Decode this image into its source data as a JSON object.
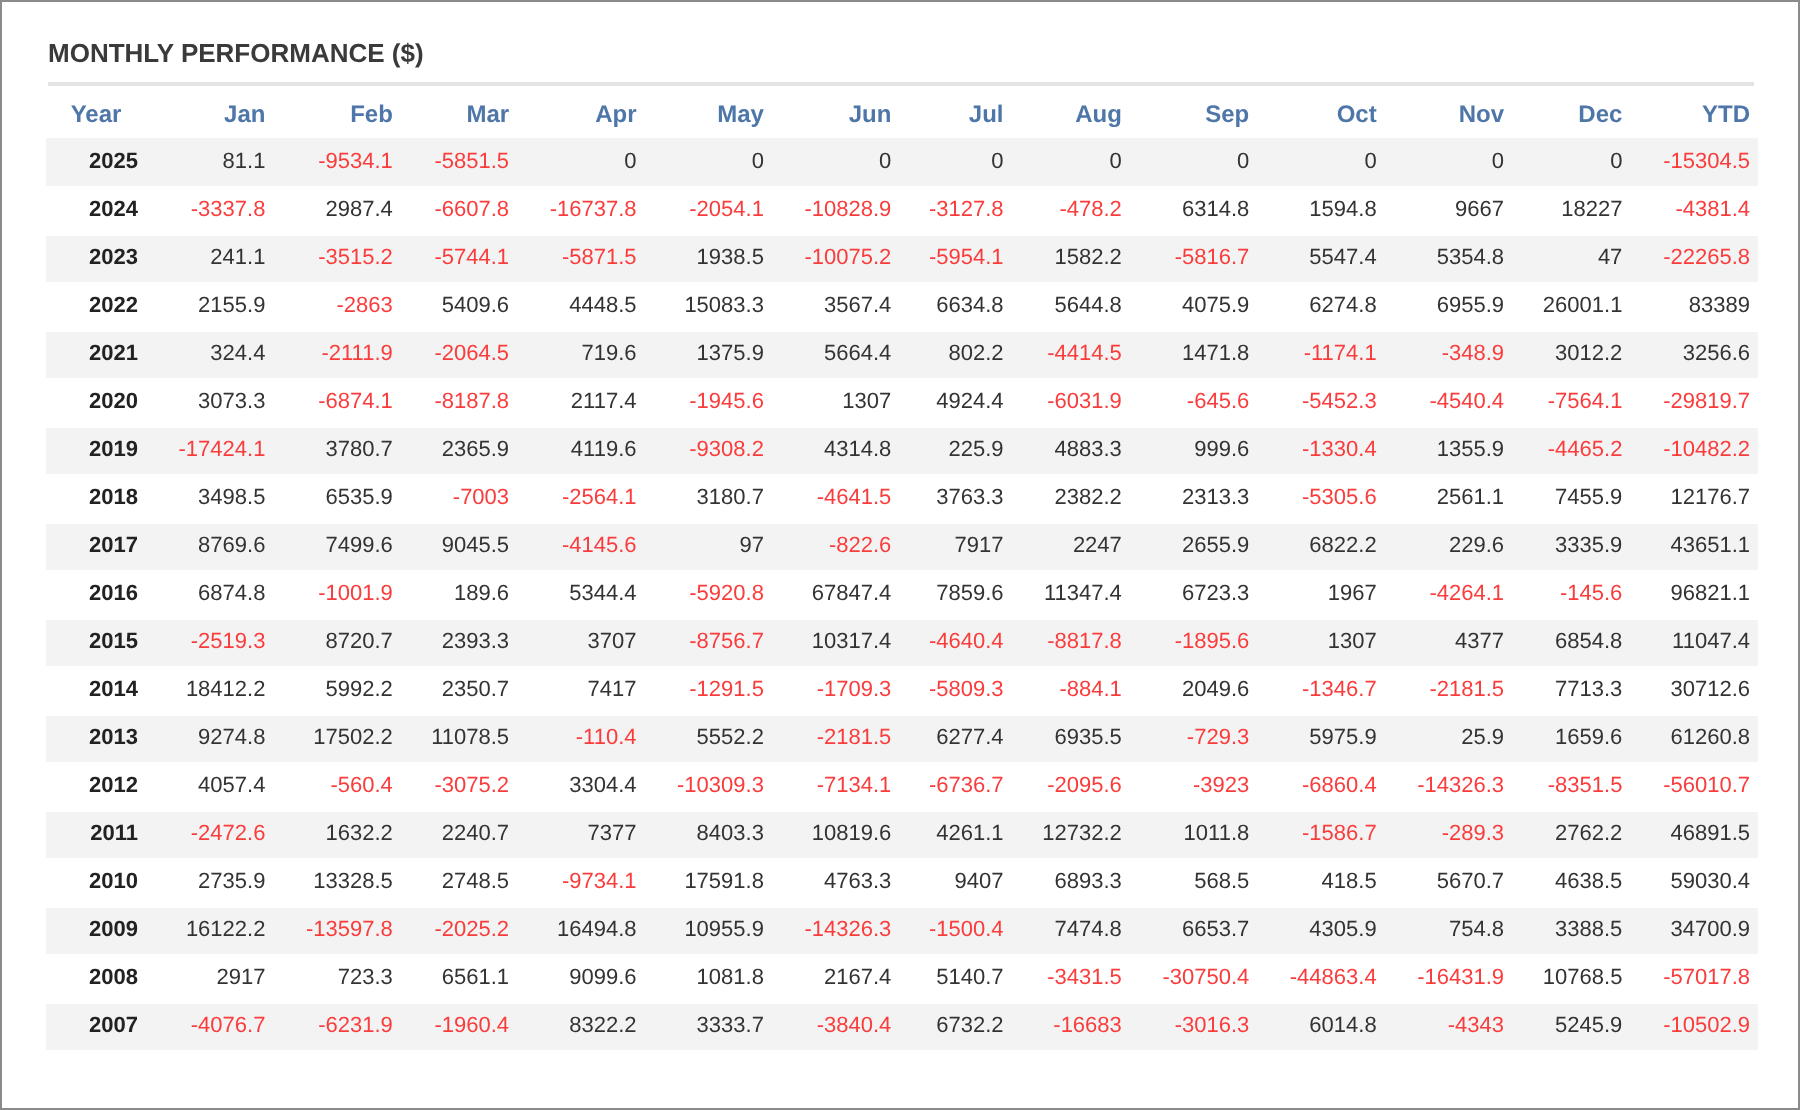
{
  "title": "MONTHLY PERFORMANCE ($)",
  "table": {
    "columns": [
      "Year",
      "Jan",
      "Feb",
      "Mar",
      "Apr",
      "May",
      "Jun",
      "Jul",
      "Aug",
      "Sep",
      "Oct",
      "Nov",
      "Dec",
      "YTD"
    ],
    "rows": [
      {
        "cells": [
          {
            "text": "2025"
          },
          {
            "text": "81.1",
            "negative": false
          },
          {
            "text": "-9534.1",
            "negative": true
          },
          {
            "text": "-5851.5",
            "negative": true
          },
          {
            "text": "0",
            "negative": false
          },
          {
            "text": "0",
            "negative": false
          },
          {
            "text": "0",
            "negative": false
          },
          {
            "text": "0",
            "negative": false
          },
          {
            "text": "0",
            "negative": false
          },
          {
            "text": "0",
            "negative": false
          },
          {
            "text": "0",
            "negative": false
          },
          {
            "text": "0",
            "negative": false
          },
          {
            "text": "0",
            "negative": false
          },
          {
            "text": "-15304.5",
            "negative": true
          }
        ]
      },
      {
        "cells": [
          {
            "text": "2024"
          },
          {
            "text": "-3337.8",
            "negative": true
          },
          {
            "text": "2987.4",
            "negative": false
          },
          {
            "text": "-6607.8",
            "negative": true
          },
          {
            "text": "-16737.8",
            "negative": true
          },
          {
            "text": "-2054.1",
            "negative": true
          },
          {
            "text": "-10828.9",
            "negative": true
          },
          {
            "text": "-3127.8",
            "negative": true
          },
          {
            "text": "-478.2",
            "negative": true
          },
          {
            "text": "6314.8",
            "negative": false
          },
          {
            "text": "1594.8",
            "negative": false
          },
          {
            "text": "9667",
            "negative": false
          },
          {
            "text": "18227",
            "negative": false
          },
          {
            "text": "-4381.4",
            "negative": true
          }
        ]
      },
      {
        "cells": [
          {
            "text": "2023"
          },
          {
            "text": "241.1",
            "negative": false
          },
          {
            "text": "-3515.2",
            "negative": true
          },
          {
            "text": "-5744.1",
            "negative": true
          },
          {
            "text": "-5871.5",
            "negative": true
          },
          {
            "text": "1938.5",
            "negative": false
          },
          {
            "text": "-10075.2",
            "negative": true
          },
          {
            "text": "-5954.1",
            "negative": true
          },
          {
            "text": "1582.2",
            "negative": false
          },
          {
            "text": "-5816.7",
            "negative": true
          },
          {
            "text": "5547.4",
            "negative": false
          },
          {
            "text": "5354.8",
            "negative": false
          },
          {
            "text": "47",
            "negative": false
          },
          {
            "text": "-22265.8",
            "negative": true
          }
        ]
      },
      {
        "cells": [
          {
            "text": "2022"
          },
          {
            "text": "2155.9",
            "negative": false
          },
          {
            "text": "-2863",
            "negative": true
          },
          {
            "text": "5409.6",
            "negative": false
          },
          {
            "text": "4448.5",
            "negative": false
          },
          {
            "text": "15083.3",
            "negative": false
          },
          {
            "text": "3567.4",
            "negative": false
          },
          {
            "text": "6634.8",
            "negative": false
          },
          {
            "text": "5644.8",
            "negative": false
          },
          {
            "text": "4075.9",
            "negative": false
          },
          {
            "text": "6274.8",
            "negative": false
          },
          {
            "text": "6955.9",
            "negative": false
          },
          {
            "text": "26001.1",
            "negative": false
          },
          {
            "text": "83389",
            "negative": false
          }
        ]
      },
      {
        "cells": [
          {
            "text": "2021"
          },
          {
            "text": "324.4",
            "negative": false
          },
          {
            "text": "-2111.9",
            "negative": true
          },
          {
            "text": "-2064.5",
            "negative": true
          },
          {
            "text": "719.6",
            "negative": false
          },
          {
            "text": "1375.9",
            "negative": false
          },
          {
            "text": "5664.4",
            "negative": false
          },
          {
            "text": "802.2",
            "negative": false
          },
          {
            "text": "-4414.5",
            "negative": true
          },
          {
            "text": "1471.8",
            "negative": false
          },
          {
            "text": "-1174.1",
            "negative": true
          },
          {
            "text": "-348.9",
            "negative": true
          },
          {
            "text": "3012.2",
            "negative": false
          },
          {
            "text": "3256.6",
            "negative": false
          }
        ]
      },
      {
        "cells": [
          {
            "text": "2020"
          },
          {
            "text": "3073.3",
            "negative": false
          },
          {
            "text": "-6874.1",
            "negative": true
          },
          {
            "text": "-8187.8",
            "negative": true
          },
          {
            "text": "2117.4",
            "negative": false
          },
          {
            "text": "-1945.6",
            "negative": true
          },
          {
            "text": "1307",
            "negative": false
          },
          {
            "text": "4924.4",
            "negative": false
          },
          {
            "text": "-6031.9",
            "negative": true
          },
          {
            "text": "-645.6",
            "negative": true
          },
          {
            "text": "-5452.3",
            "negative": true
          },
          {
            "text": "-4540.4",
            "negative": true
          },
          {
            "text": "-7564.1",
            "negative": true
          },
          {
            "text": "-29819.7",
            "negative": true
          }
        ]
      },
      {
        "cells": [
          {
            "text": "2019"
          },
          {
            "text": "-17424.1",
            "negative": true
          },
          {
            "text": "3780.7",
            "negative": false
          },
          {
            "text": "2365.9",
            "negative": false
          },
          {
            "text": "4119.6",
            "negative": false
          },
          {
            "text": "-9308.2",
            "negative": true
          },
          {
            "text": "4314.8",
            "negative": false
          },
          {
            "text": "225.9",
            "negative": false
          },
          {
            "text": "4883.3",
            "negative": false
          },
          {
            "text": "999.6",
            "negative": false
          },
          {
            "text": "-1330.4",
            "negative": true
          },
          {
            "text": "1355.9",
            "negative": false
          },
          {
            "text": "-4465.2",
            "negative": true
          },
          {
            "text": "-10482.2",
            "negative": true
          }
        ]
      },
      {
        "cells": [
          {
            "text": "2018"
          },
          {
            "text": "3498.5",
            "negative": false
          },
          {
            "text": "6535.9",
            "negative": false
          },
          {
            "text": "-7003",
            "negative": true
          },
          {
            "text": "-2564.1",
            "negative": true
          },
          {
            "text": "3180.7",
            "negative": false
          },
          {
            "text": "-4641.5",
            "negative": true
          },
          {
            "text": "3763.3",
            "negative": false
          },
          {
            "text": "2382.2",
            "negative": false
          },
          {
            "text": "2313.3",
            "negative": false
          },
          {
            "text": "-5305.6",
            "negative": true
          },
          {
            "text": "2561.1",
            "negative": false
          },
          {
            "text": "7455.9",
            "negative": false
          },
          {
            "text": "12176.7",
            "negative": false
          }
        ]
      },
      {
        "cells": [
          {
            "text": "2017"
          },
          {
            "text": "8769.6",
            "negative": false
          },
          {
            "text": "7499.6",
            "negative": false
          },
          {
            "text": "9045.5",
            "negative": false
          },
          {
            "text": "-4145.6",
            "negative": true
          },
          {
            "text": "97",
            "negative": false
          },
          {
            "text": "-822.6",
            "negative": true
          },
          {
            "text": "7917",
            "negative": false
          },
          {
            "text": "2247",
            "negative": false
          },
          {
            "text": "2655.9",
            "negative": false
          },
          {
            "text": "6822.2",
            "negative": false
          },
          {
            "text": "229.6",
            "negative": false
          },
          {
            "text": "3335.9",
            "negative": false
          },
          {
            "text": "43651.1",
            "negative": false
          }
        ]
      },
      {
        "cells": [
          {
            "text": "2016"
          },
          {
            "text": "6874.8",
            "negative": false
          },
          {
            "text": "-1001.9",
            "negative": true
          },
          {
            "text": "189.6",
            "negative": false
          },
          {
            "text": "5344.4",
            "negative": false
          },
          {
            "text": "-5920.8",
            "negative": true
          },
          {
            "text": "67847.4",
            "negative": false
          },
          {
            "text": "7859.6",
            "negative": false
          },
          {
            "text": "11347.4",
            "negative": false
          },
          {
            "text": "6723.3",
            "negative": false
          },
          {
            "text": "1967",
            "negative": false
          },
          {
            "text": "-4264.1",
            "negative": true
          },
          {
            "text": "-145.6",
            "negative": true
          },
          {
            "text": "96821.1",
            "negative": false
          }
        ]
      },
      {
        "cells": [
          {
            "text": "2015"
          },
          {
            "text": "-2519.3",
            "negative": true
          },
          {
            "text": "8720.7",
            "negative": false
          },
          {
            "text": "2393.3",
            "negative": false
          },
          {
            "text": "3707",
            "negative": false
          },
          {
            "text": "-8756.7",
            "negative": true
          },
          {
            "text": "10317.4",
            "negative": false
          },
          {
            "text": "-4640.4",
            "negative": true
          },
          {
            "text": "-8817.8",
            "negative": true
          },
          {
            "text": "-1895.6",
            "negative": true
          },
          {
            "text": "1307",
            "negative": false
          },
          {
            "text": "4377",
            "negative": false
          },
          {
            "text": "6854.8",
            "negative": false
          },
          {
            "text": "11047.4",
            "negative": false
          }
        ]
      },
      {
        "cells": [
          {
            "text": "2014"
          },
          {
            "text": "18412.2",
            "negative": false
          },
          {
            "text": "5992.2",
            "negative": false
          },
          {
            "text": "2350.7",
            "negative": false
          },
          {
            "text": "7417",
            "negative": false
          },
          {
            "text": "-1291.5",
            "negative": true
          },
          {
            "text": "-1709.3",
            "negative": true
          },
          {
            "text": "-5809.3",
            "negative": true
          },
          {
            "text": "-884.1",
            "negative": true
          },
          {
            "text": "2049.6",
            "negative": false
          },
          {
            "text": "-1346.7",
            "negative": true
          },
          {
            "text": "-2181.5",
            "negative": true
          },
          {
            "text": "7713.3",
            "negative": false
          },
          {
            "text": "30712.6",
            "negative": false
          }
        ]
      },
      {
        "cells": [
          {
            "text": "2013"
          },
          {
            "text": "9274.8",
            "negative": false
          },
          {
            "text": "17502.2",
            "negative": false
          },
          {
            "text": "11078.5",
            "negative": false
          },
          {
            "text": "-110.4",
            "negative": true
          },
          {
            "text": "5552.2",
            "negative": false
          },
          {
            "text": "-2181.5",
            "negative": true
          },
          {
            "text": "6277.4",
            "negative": false
          },
          {
            "text": "6935.5",
            "negative": false
          },
          {
            "text": "-729.3",
            "negative": true
          },
          {
            "text": "5975.9",
            "negative": false
          },
          {
            "text": "25.9",
            "negative": false
          },
          {
            "text": "1659.6",
            "negative": false
          },
          {
            "text": "61260.8",
            "negative": false
          }
        ]
      },
      {
        "cells": [
          {
            "text": "2012"
          },
          {
            "text": "4057.4",
            "negative": false
          },
          {
            "text": "-560.4",
            "negative": true
          },
          {
            "text": "-3075.2",
            "negative": true
          },
          {
            "text": "3304.4",
            "negative": false
          },
          {
            "text": "-10309.3",
            "negative": true
          },
          {
            "text": "-7134.1",
            "negative": true
          },
          {
            "text": "-6736.7",
            "negative": true
          },
          {
            "text": "-2095.6",
            "negative": true
          },
          {
            "text": "-3923",
            "negative": true
          },
          {
            "text": "-6860.4",
            "negative": true
          },
          {
            "text": "-14326.3",
            "negative": true
          },
          {
            "text": "-8351.5",
            "negative": true
          },
          {
            "text": "-56010.7",
            "negative": true
          }
        ]
      },
      {
        "cells": [
          {
            "text": "2011"
          },
          {
            "text": "-2472.6",
            "negative": true
          },
          {
            "text": "1632.2",
            "negative": false
          },
          {
            "text": "2240.7",
            "negative": false
          },
          {
            "text": "7377",
            "negative": false
          },
          {
            "text": "8403.3",
            "negative": false
          },
          {
            "text": "10819.6",
            "negative": false
          },
          {
            "text": "4261.1",
            "negative": false
          },
          {
            "text": "12732.2",
            "negative": false
          },
          {
            "text": "1011.8",
            "negative": false
          },
          {
            "text": "-1586.7",
            "negative": true
          },
          {
            "text": "-289.3",
            "negative": true
          },
          {
            "text": "2762.2",
            "negative": false
          },
          {
            "text": "46891.5",
            "negative": false
          }
        ]
      },
      {
        "cells": [
          {
            "text": "2010"
          },
          {
            "text": "2735.9",
            "negative": false
          },
          {
            "text": "13328.5",
            "negative": false
          },
          {
            "text": "2748.5",
            "negative": false
          },
          {
            "text": "-9734.1",
            "negative": true
          },
          {
            "text": "17591.8",
            "negative": false
          },
          {
            "text": "4763.3",
            "negative": false
          },
          {
            "text": "9407",
            "negative": false
          },
          {
            "text": "6893.3",
            "negative": false
          },
          {
            "text": "568.5",
            "negative": false
          },
          {
            "text": "418.5",
            "negative": false
          },
          {
            "text": "5670.7",
            "negative": false
          },
          {
            "text": "4638.5",
            "negative": false
          },
          {
            "text": "59030.4",
            "negative": false
          }
        ]
      },
      {
        "cells": [
          {
            "text": "2009"
          },
          {
            "text": "16122.2",
            "negative": false
          },
          {
            "text": "-13597.8",
            "negative": true
          },
          {
            "text": "-2025.2",
            "negative": true
          },
          {
            "text": "16494.8",
            "negative": false
          },
          {
            "text": "10955.9",
            "negative": false
          },
          {
            "text": "-14326.3",
            "negative": true
          },
          {
            "text": "-1500.4",
            "negative": true
          },
          {
            "text": "7474.8",
            "negative": false
          },
          {
            "text": "6653.7",
            "negative": false
          },
          {
            "text": "4305.9",
            "negative": false
          },
          {
            "text": "754.8",
            "negative": false
          },
          {
            "text": "3388.5",
            "negative": false
          },
          {
            "text": "34700.9",
            "negative": false
          }
        ]
      },
      {
        "cells": [
          {
            "text": "2008"
          },
          {
            "text": "2917",
            "negative": false
          },
          {
            "text": "723.3",
            "negative": false
          },
          {
            "text": "6561.1",
            "negative": false
          },
          {
            "text": "9099.6",
            "negative": false
          },
          {
            "text": "1081.8",
            "negative": false
          },
          {
            "text": "2167.4",
            "negative": false
          },
          {
            "text": "5140.7",
            "negative": false
          },
          {
            "text": "-3431.5",
            "negative": true
          },
          {
            "text": "-30750.4",
            "negative": true
          },
          {
            "text": "-44863.4",
            "negative": true
          },
          {
            "text": "-16431.9",
            "negative": true
          },
          {
            "text": "10768.5",
            "negative": false
          },
          {
            "text": "-57017.8",
            "negative": true
          }
        ]
      },
      {
        "cells": [
          {
            "text": "2007"
          },
          {
            "text": "-4076.7",
            "negative": true
          },
          {
            "text": "-6231.9",
            "negative": true
          },
          {
            "text": "-1960.4",
            "negative": true
          },
          {
            "text": "8322.2",
            "negative": false
          },
          {
            "text": "3333.7",
            "negative": false
          },
          {
            "text": "-3840.4",
            "negative": true
          },
          {
            "text": "6732.2",
            "negative": false
          },
          {
            "text": "-16683",
            "negative": true
          },
          {
            "text": "-3016.3",
            "negative": true
          },
          {
            "text": "6014.8",
            "negative": false
          },
          {
            "text": "-4343",
            "negative": true
          },
          {
            "text": "5245.9",
            "negative": false
          },
          {
            "text": "-10502.9",
            "negative": true
          }
        ]
      }
    ]
  }
}
